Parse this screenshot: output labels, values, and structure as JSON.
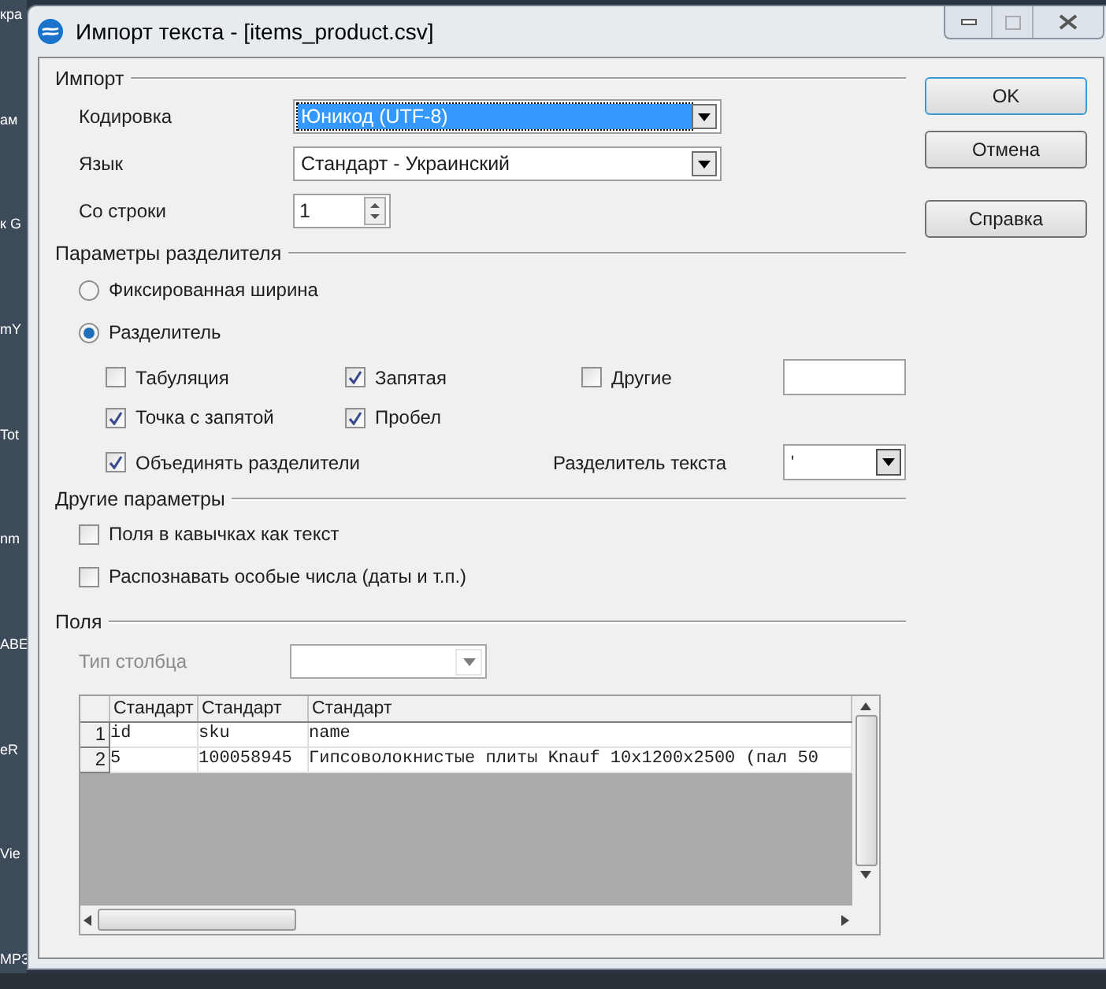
{
  "desktop_labels": [
    "кра",
    "ам",
    "к G",
    "mY",
    "Tot",
    "nm",
    "ABE",
    "eR",
    "Vie",
    "MP3"
  ],
  "window": {
    "title": "Импорт текста - [items_product.csv]"
  },
  "import": {
    "heading": "Импорт",
    "fields": [
      {
        "label": "Кодировка",
        "kind": "dropdown",
        "value": "Юникод (UTF-8)",
        "focused": true
      },
      {
        "label": "Язык",
        "kind": "dropdown",
        "value": "Стандарт - Украинский",
        "focused": false
      },
      {
        "label": "Со строки",
        "kind": "spin",
        "value": "1"
      }
    ]
  },
  "separator": {
    "heading": "Параметры разделителя",
    "modes": [
      {
        "label": "Фиксированная ширина",
        "selected": false
      },
      {
        "label": "Разделитель",
        "selected": true
      }
    ],
    "rows": [
      [
        {
          "kind": "checkbox",
          "label": "Табуляция",
          "checked": false
        },
        {
          "kind": "checkbox",
          "label": "Запятая",
          "checked": true
        },
        {
          "kind": "checkbox_field",
          "label": "Другие",
          "checked": false
        }
      ],
      [
        {
          "kind": "checkbox",
          "label": "Точка с запятой",
          "checked": true
        },
        {
          "kind": "checkbox",
          "label": "Пробел",
          "checked": true
        }
      ],
      [
        {
          "kind": "checkbox",
          "label": "Объединять разделители",
          "checked": true
        },
        "",
        {
          "kind": "combo",
          "label": "Разделитель текста",
          "value": "'"
        }
      ]
    ]
  },
  "other": {
    "heading": "Другие параметры",
    "options": [
      {
        "label": "Поля в кавычках как текст",
        "checked": false
      },
      {
        "label": "Распознавать особые числа (даты и т.п.)",
        "checked": false
      }
    ]
  },
  "fields": {
    "heading": "Поля",
    "column_type": {
      "label": "Тип столбца",
      "disabled": true
    },
    "table": {
      "columns": [
        "Стандарт",
        "Стандарт",
        "Стандарт"
      ],
      "rows": [
        {
          "number": "1",
          "cells": [
            "id",
            "sku",
            "name"
          ]
        },
        {
          "number": "2",
          "cells": [
            "5",
            "100058945",
            "Гипсоволокнистые плиты Knauf 10x1200x2500 (пал 50"
          ]
        }
      ]
    }
  },
  "buttons": [
    {
      "label": "OK",
      "default": true
    },
    {
      "label": "Отмена",
      "default": false
    },
    {
      "label": "Справка",
      "default": false
    }
  ]
}
